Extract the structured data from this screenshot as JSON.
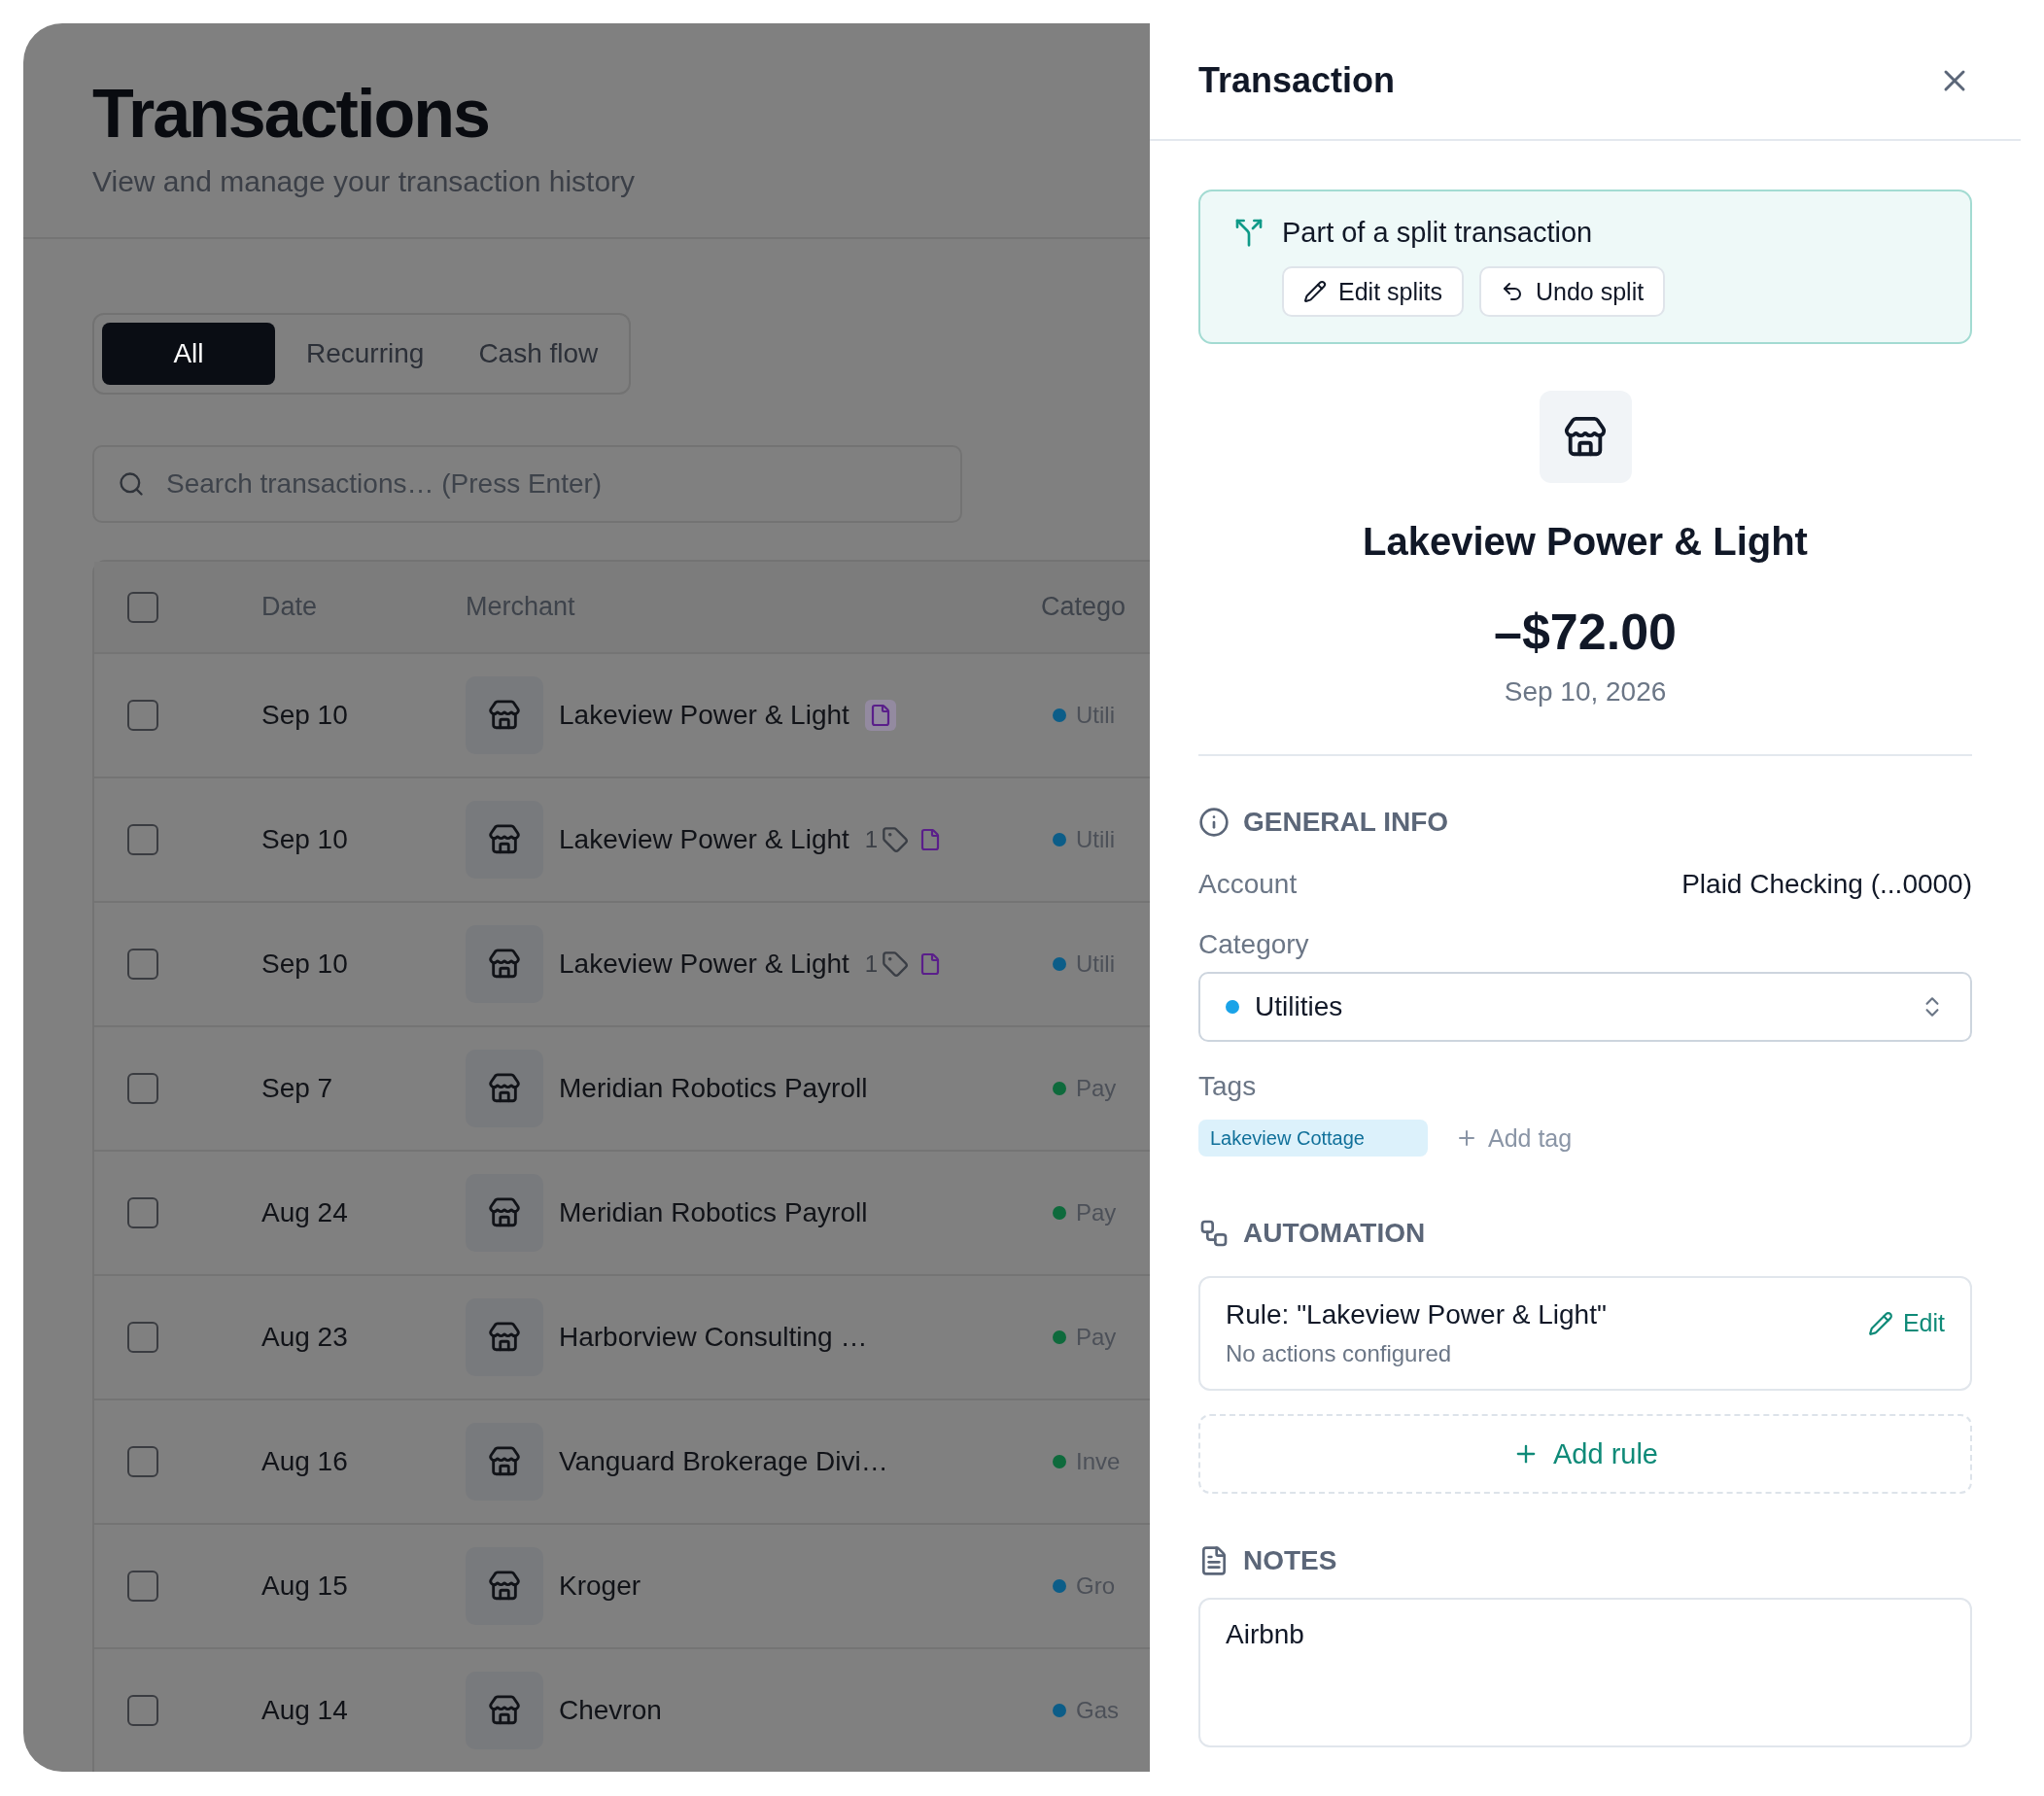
{
  "page": {
    "title": "Transactions",
    "subtitle": "View and manage your transaction history"
  },
  "tabs": [
    {
      "label": "All",
      "selected": true
    },
    {
      "label": "Recurring",
      "selected": false
    },
    {
      "label": "Cash flow",
      "selected": false
    }
  ],
  "search": {
    "placeholder": "Search transactions… (Press Enter)"
  },
  "table": {
    "select_all": {
      "checked": false
    },
    "columns": [
      "Date",
      "Merchant",
      "Catego"
    ],
    "rows": [
      {
        "checked": false,
        "date": "Sep 10",
        "merchant": "Lakeview Power & Light",
        "note": true,
        "note_highlight": true,
        "category": "Utili",
        "color": "#0c5d88"
      },
      {
        "checked": false,
        "date": "Sep 10",
        "merchant": "Lakeview Power & Light",
        "tag_count": "1",
        "note": true,
        "note_highlight": false,
        "category": "Utili",
        "color": "#0c5d88"
      },
      {
        "checked": false,
        "date": "Sep 10",
        "merchant": "Lakeview Power & Light",
        "tag_count": "1",
        "note": true,
        "note_highlight": false,
        "category": "Utili",
        "color": "#0c5d88"
      },
      {
        "checked": false,
        "date": "Sep 7",
        "merchant": "Meridian Robotics Payroll",
        "note": false,
        "category": "Pay",
        "color": "#0e6a3c"
      },
      {
        "checked": false,
        "date": "Aug 24",
        "merchant": "Meridian Robotics Payroll",
        "note": false,
        "category": "Pay",
        "color": "#0e6a3c"
      },
      {
        "checked": false,
        "date": "Aug 23",
        "merchant": "Harborview Consulting …",
        "note": false,
        "category": "Pay",
        "color": "#0e6a3c"
      },
      {
        "checked": false,
        "date": "Aug 16",
        "merchant": "Vanguard Brokerage Divi…",
        "note": false,
        "category": "Inve",
        "color": "#0e6a3c"
      },
      {
        "checked": false,
        "date": "Aug 15",
        "merchant": "Kroger",
        "note": false,
        "category": "Gro",
        "color": "#0c5d88"
      },
      {
        "checked": false,
        "date": "Aug 14",
        "merchant": "Chevron",
        "note": false,
        "category": "Gas",
        "color": "#0c5d88"
      }
    ]
  },
  "panel": {
    "title": "Transaction",
    "split": {
      "text": "Part of a split transaction",
      "buttons": [
        {
          "kind": "edit",
          "label": "Edit splits"
        },
        {
          "kind": "undo",
          "label": "Undo split"
        }
      ]
    },
    "merchant": "Lakeview Power & Light",
    "amount": "–$72.00",
    "date": "Sep 10, 2026",
    "general": {
      "heading": "GENERAL INFO",
      "account_label": "Account",
      "account_value": "Plaid Checking (...0000)",
      "category_label": "Category",
      "category": {
        "value": "Utilities",
        "color": "#1aa3e8"
      },
      "tags_label": "Tags",
      "tags": [
        "Lakeview Cottage"
      ],
      "add_tag": "Add tag"
    },
    "automation": {
      "heading": "AUTOMATION",
      "rule": {
        "title": "Rule: \"Lakeview Power & Light\"",
        "subtitle": "No actions configured",
        "edit": "Edit"
      },
      "add_rule": "Add rule"
    },
    "notes": {
      "heading": "NOTES",
      "value": "Airbnb"
    }
  }
}
